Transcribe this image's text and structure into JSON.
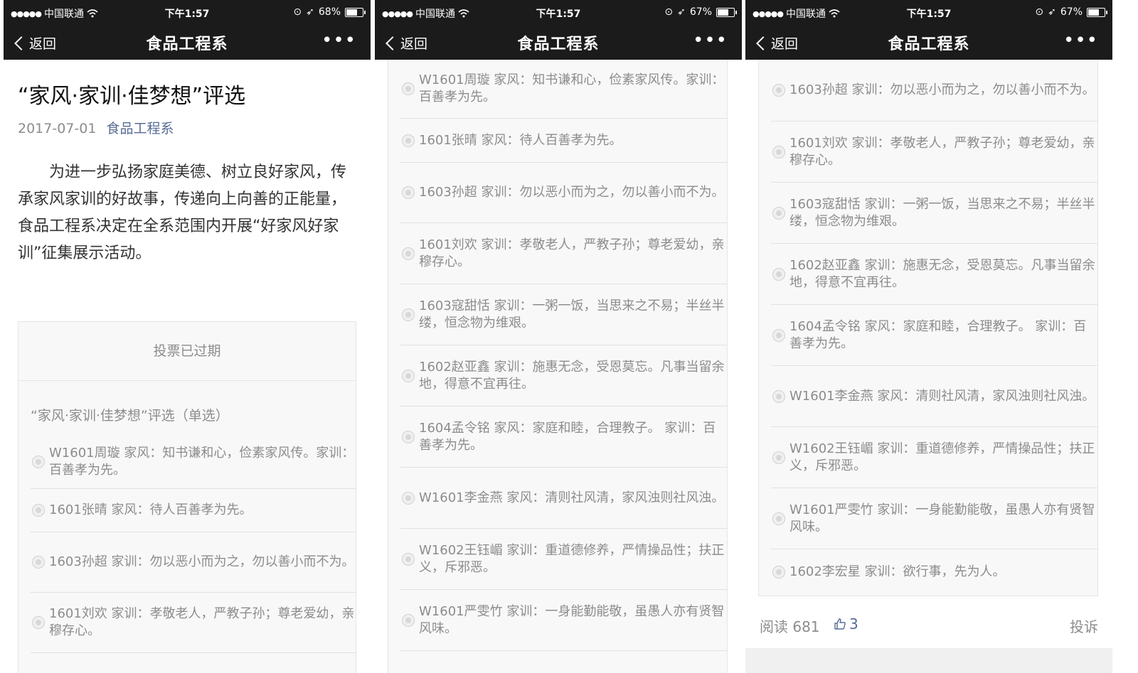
{
  "status_bar": {
    "carrier": "中国联通",
    "time": "下午1:57",
    "panels": [
      {
        "battery": "68%",
        "battery_level": 0.68
      },
      {
        "battery": "67%",
        "battery_level": 0.67
      },
      {
        "battery": "67%",
        "battery_level": 0.67
      }
    ]
  },
  "navbar": {
    "back_label": "返回",
    "title": "食品工程系",
    "more_label": "•••"
  },
  "article": {
    "title": "“家风·家训·佳梦想”评选",
    "date": "2017-07-01",
    "author": "食品工程系",
    "body": "为进一步弘扬家庭美德、树立良好家风，传承家风家训的好故事，传递向上向善的正能量，食品工程系决定在全系范围内开展“好家风好家训”征集展示活动。"
  },
  "vote": {
    "expired_label": "投票已过期",
    "question": "“家风·家训·佳梦想”评选（单选）",
    "options": [
      "W1601周璇 家风：知书谦和心，俭素家风传。家训：百善孝为先。",
      "1601张晴 家风：待人百善孝为先。",
      "1603孙超 家训：勿以恶小而为之，勿以善小而不为。",
      "1601刘欢 家训：孝敬老人，严教子孙；尊老爱幼，亲穆存心。",
      "1603寇甜恬 家训：一粥一饭，当思来之不易；半丝半缕，恒念物为维艰。",
      "1602赵亚鑫 家训：施惠无念，受恩莫忘。凡事当留余地，得意不宜再往。",
      "1604孟令铭 家风：家庭和睦，合理教子。 家训：百善孝为先。",
      "W1601李金燕 家风：清则社风清，家风浊则社风浊。",
      "W1602王钰嵋 家训：重道德修养，严情操品性；扶正义，斥邪恶。",
      "W1601严雯竹 家训：一身能勤能敬，虽愚人亦有贤智风味。",
      "1602李宏星 家训：欲行事，先为人。"
    ]
  },
  "footer": {
    "read_label": "阅读 681",
    "like_count": "3",
    "report_label": "投诉"
  },
  "icons": {
    "wifi": "wifi-icon",
    "back": "chevron-left-icon",
    "more": "more-icon",
    "radio": "radio-icon",
    "like": "thumbs-up-icon"
  },
  "colors": {
    "navbar": "#1b1b1b",
    "link": "#576b95",
    "muted": "#8c8c8c",
    "vote_bg": "#f8f8f8"
  }
}
